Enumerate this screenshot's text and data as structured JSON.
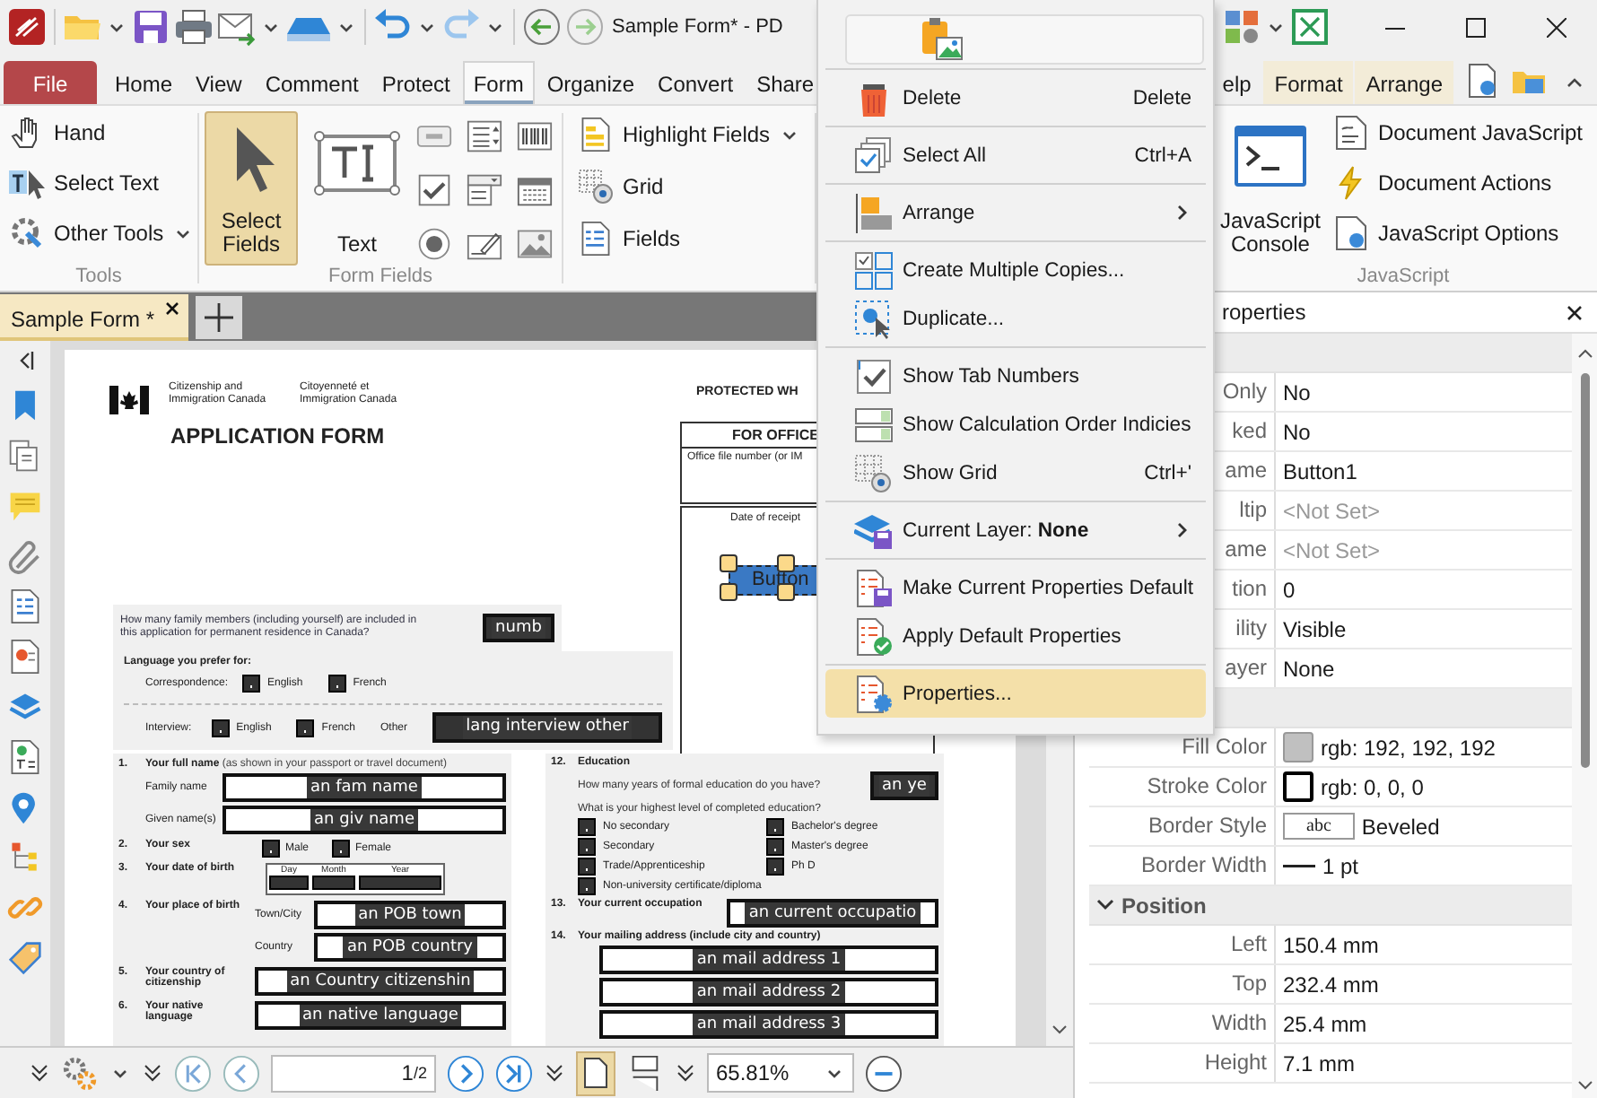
{
  "title_bar": {
    "title": "Sample Form* - PD"
  },
  "menu_tabs": [
    {
      "label": "File",
      "kind": "file",
      "selected": false
    },
    {
      "label": "Home",
      "kind": "tab",
      "selected": false
    },
    {
      "label": "View",
      "kind": "tab",
      "selected": false
    },
    {
      "label": "Comment",
      "kind": "tab",
      "selected": false
    },
    {
      "label": "Protect",
      "kind": "tab",
      "selected": false
    },
    {
      "label": "Form",
      "kind": "tab",
      "selected": true
    },
    {
      "label": "Organize",
      "kind": "tab",
      "selected": false
    },
    {
      "label": "Convert",
      "kind": "tab",
      "selected": false
    },
    {
      "label": "Share",
      "kind": "tab",
      "selected": false
    },
    {
      "label": "elp",
      "kind": "tab",
      "selected": false
    },
    {
      "label": "Format",
      "kind": "context",
      "selected": false
    },
    {
      "label": "Arrange",
      "kind": "context",
      "selected": false
    }
  ],
  "ribbon": {
    "tools": {
      "items": [
        "Hand",
        "Select Text",
        "Other Tools"
      ],
      "label": "Tools"
    },
    "select_fields": {
      "label": "Select Fields",
      "selected": true
    },
    "text_field": "Text",
    "form_fields_label": "Form Fields",
    "view_items": [
      "Highlight Fields",
      "Grid",
      "Fields"
    ],
    "javascript": {
      "console": "JavaScript Console",
      "items": [
        "Document JavaScript",
        "Document Actions",
        "JavaScript Options"
      ],
      "label": "JavaScript"
    }
  },
  "doc_tabs": [
    {
      "label": "Sample Form *",
      "selected": true
    }
  ],
  "context_menu": {
    "groups": [
      [
        {
          "label": "Delete",
          "shortcut": "Delete",
          "submenu": false,
          "selected": false
        }
      ],
      [
        {
          "label": "Select All",
          "shortcut": "Ctrl+A",
          "submenu": false,
          "selected": false
        }
      ],
      [
        {
          "label": "Arrange",
          "submenu": true,
          "selected": false
        }
      ],
      [
        {
          "label": "Create Multiple Copies...",
          "submenu": false,
          "selected": false
        },
        {
          "label": "Duplicate...",
          "submenu": false,
          "selected": false
        }
      ],
      [
        {
          "label": "Show Tab Numbers",
          "submenu": false,
          "selected": false
        },
        {
          "label": "Show Calculation Order Indicies",
          "submenu": false,
          "selected": false
        },
        {
          "label": "Show Grid",
          "shortcut": "Ctrl+'",
          "submenu": false,
          "selected": false
        }
      ],
      [
        {
          "label": "Current Layer: **None**",
          "submenu": true,
          "selected": false
        }
      ],
      [
        {
          "label": "Make Current Properties Default",
          "submenu": false,
          "selected": false
        },
        {
          "label": "Apply Default Properties",
          "submenu": false,
          "selected": false
        }
      ],
      [
        {
          "label": "Properties...",
          "submenu": false,
          "selected": true
        }
      ]
    ]
  },
  "properties_panel": {
    "title": "roperties",
    "sections": [
      {
        "rows": [
          {
            "label": "Only",
            "value": "No",
            "kind": "text"
          },
          {
            "label": "ked",
            "value": "No",
            "kind": "text"
          },
          {
            "label": "ame",
            "value": "Button1",
            "kind": "text"
          },
          {
            "label": "ltip",
            "value": "<Not Set>",
            "kind": "placeholder"
          },
          {
            "label": "ame",
            "value": "<Not Set>",
            "kind": "placeholder"
          },
          {
            "label": "tion",
            "value": "0",
            "kind": "text"
          },
          {
            "label": "ility",
            "value": "Visible",
            "kind": "text"
          },
          {
            "label": "ayer",
            "value": "None",
            "kind": "text"
          }
        ]
      },
      {
        "rows": [
          {
            "label": "Fill Color",
            "value": "rgb: 192, 192, 192",
            "kind": "fill_color",
            "color": "#c0c0c0"
          },
          {
            "label": "Stroke Color",
            "value": "rgb: 0, 0, 0",
            "kind": "stroke_color",
            "color": "#000000"
          },
          {
            "label": "Border Style",
            "value": "Beveled",
            "kind": "style",
            "sample": "abc"
          },
          {
            "label": "Border Width",
            "value": "1 pt",
            "kind": "line"
          }
        ]
      },
      {
        "title": "Position",
        "expanded": true,
        "rows": [
          {
            "label": "Left",
            "value": "150.4 mm",
            "kind": "text"
          },
          {
            "label": "Top",
            "value": "232.4 mm",
            "kind": "text"
          },
          {
            "label": "Width",
            "value": "25.4 mm",
            "kind": "text"
          },
          {
            "label": "Height",
            "value": "7.1 mm",
            "kind": "text"
          }
        ]
      }
    ]
  },
  "document": {
    "agency_en": [
      "Citizenship and",
      "Immigration Canada"
    ],
    "agency_fr": [
      "Citoyenneté et",
      "Immigration Canada"
    ],
    "title": "APPLICATION FORM",
    "protected": "PROTECTED WH",
    "office_box": {
      "title": "FOR OFFICE",
      "text": "Office file number (or IM"
    },
    "receipt_box": {
      "label": "Date of receipt",
      "button": "Button"
    },
    "family_question": {
      "text": "How many family members (including yourself) are included in this application for permanent residence in Canada?",
      "field": "numb"
    },
    "language": {
      "title": "Language you prefer for:",
      "rows": [
        {
          "label": "Correspondence:",
          "options": [
            {
              "label": "English",
              "checked": false
            },
            {
              "label": "French",
              "checked": false
            }
          ]
        },
        {
          "label": "Interview:",
          "options": [
            {
              "label": "English",
              "checked": false
            },
            {
              "label": "French",
              "checked": false
            }
          ],
          "other": "Other",
          "field": "lang interview other"
        }
      ]
    },
    "questions_left": [
      {
        "number": "1.",
        "text": "Your full name",
        "note": "(as shown in your passport or travel document)",
        "kind": "name",
        "fields": [
          {
            "label": "Family name",
            "value": "an fam name"
          },
          {
            "label": "Given name(s)",
            "value": "an giv name"
          }
        ]
      },
      {
        "number": "2.",
        "text": "Your sex",
        "kind": "choices",
        "options": [
          {
            "label": "Male",
            "checked": false
          },
          {
            "label": "Female",
            "checked": false
          }
        ]
      },
      {
        "number": "3.",
        "text": "Your date of birth",
        "kind": "date",
        "parts": [
          "Day",
          "Month",
          "Year"
        ]
      },
      {
        "number": "4.",
        "text": "Your place of birth",
        "kind": "fields",
        "fields": [
          {
            "label": "Town/City",
            "value": "an POB town"
          },
          {
            "label": "Country",
            "value": "an POB country"
          }
        ]
      },
      {
        "number": "5.",
        "text": "Your country of citizenship",
        "kind": "field",
        "value": "an Country citizenshin"
      },
      {
        "number": "6.",
        "text": "Your native language",
        "kind": "field",
        "value": "an native language"
      }
    ],
    "questions_right": [
      {
        "number": "12.",
        "text": "Education",
        "kind": "education",
        "years_question": "How many years of formal education do you have?",
        "years_field": "an ye",
        "level_question": "What is your highest level of completed education?",
        "options_left": [
          {
            "label": "No secondary",
            "checked": false
          },
          {
            "label": "Secondary",
            "checked": false
          },
          {
            "label": "Trade/Apprenticeship",
            "checked": false
          },
          {
            "label": "Non-university certificate/diploma",
            "checked": false
          }
        ],
        "options_right": [
          {
            "label": "Bachelor's degree",
            "checked": false
          },
          {
            "label": "Master's degree",
            "checked": false
          },
          {
            "label": "Ph D",
            "checked": false
          }
        ]
      },
      {
        "number": "13.",
        "text": "Your current occupation",
        "kind": "field",
        "value": "an current occupatio"
      },
      {
        "number": "14.",
        "text": "Your mailing address (include city and country)",
        "kind": "address",
        "values": [
          "an mail address 1",
          "an mail address 2",
          "an mail address 3"
        ]
      }
    ]
  },
  "status_bar": {
    "page": "1",
    "page_total": "/2",
    "zoom": "65.81%"
  }
}
